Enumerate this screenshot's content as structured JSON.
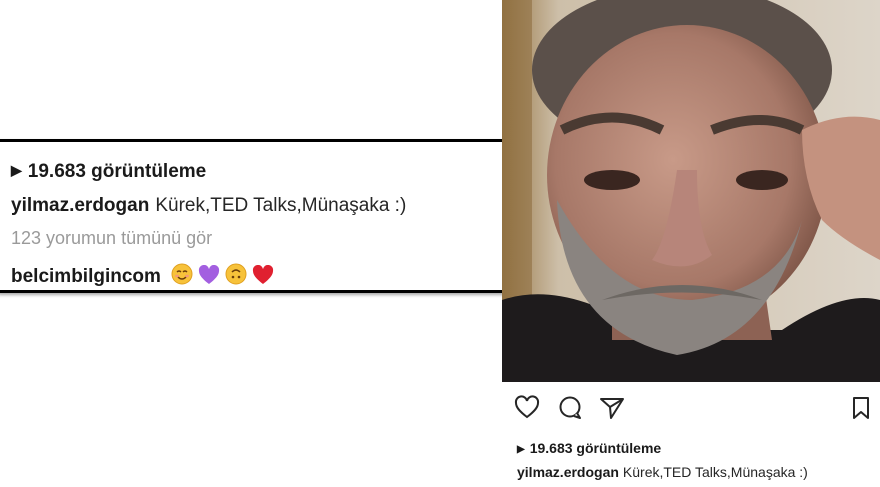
{
  "zoom": {
    "views": "19.683 görüntüleme",
    "username": "yilmaz.erdogan",
    "caption": "Kürek,TED Talks,Münaşaka :)",
    "view_all_comments": "123 yorumun tümünü gör",
    "comment_user": "belcimbilgincom",
    "comment_emojis": [
      "smiling-face-emoji",
      "purple-heart-emoji",
      "upside-down-face-emoji",
      "red-heart-emoji"
    ]
  },
  "post": {
    "views": "19.683 görüntüleme",
    "username": "yilmaz.erdogan",
    "caption": "Kürek,TED Talks,Münaşaka :)",
    "action_icons": [
      "heart-icon",
      "comment-icon",
      "share-icon",
      "bookmark-icon"
    ]
  },
  "colors": {
    "text": "#262626",
    "muted": "#9a9a9a",
    "border": "#000000"
  }
}
